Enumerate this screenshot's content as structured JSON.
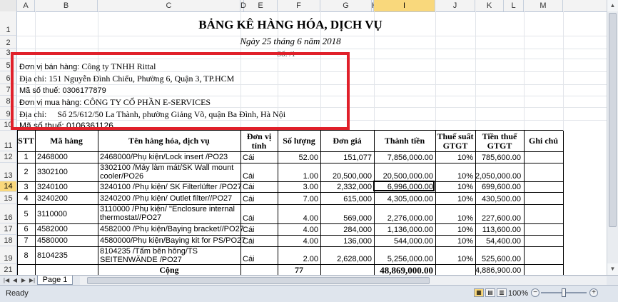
{
  "columns": [
    "A",
    "B",
    "C",
    "D",
    "E",
    "F",
    "G",
    "H",
    "I",
    "J",
    "K",
    "L",
    "M"
  ],
  "selected_column": "I",
  "rows": [
    "1",
    "2",
    "3",
    "5",
    "6",
    "7",
    "8",
    "9",
    "10",
    "11",
    "12",
    "13",
    "14",
    "15",
    "16",
    "17",
    "18",
    "19",
    "20",
    "21"
  ],
  "selected_row": "14",
  "doc": {
    "title": "BẢNG KÊ HÀNG HÓA, DỊCH VỤ",
    "date": "Ngày 25 tháng 6 năm 2018",
    "number": "Số: /1",
    "seller_label": "Đơn vị bán hàng:",
    "seller_name": "Công ty TNHH Rittal",
    "seller_address": "Địa chỉ: 151 Nguyễn Đình Chiểu, Phường 6, Quận 3, TP.HCM",
    "seller_tax": "Mã số thuế: 0306177879",
    "buyer_label": "Đơn vị mua hàng:",
    "buyer_name": "CÔNG TY CỔ PHẦN E-SERVICES",
    "buyer_address_label": "Địa chỉ:",
    "buyer_address": "Số 25/612/50 La Thành, phường Giảng Võ, quận Ba Đình, Hà Nội",
    "buyer_tax": "Mã số thuế: 0106361126"
  },
  "table_headers": {
    "stt": "STT",
    "ma_hang": "Mã hàng",
    "ten_hang": "Tên hàng hóa, dịch vụ",
    "don_vi_1": "Đơn vị",
    "don_vi_2": "tính",
    "so_luong": "Số lượng",
    "don_gia": "Đơn giá",
    "thanh_tien": "Thành tiền",
    "thue_suat_1": "Thuế suất",
    "thue_suat_2": "GTGT",
    "tien_thue_1": "Tiền thuế",
    "tien_thue_2": "GTGT",
    "ghi_chu": "Ghi chú"
  },
  "items": [
    {
      "stt": "1",
      "code": "2468000",
      "name1": "2468000/Phụ kiện/Lock insert /PO23",
      "name2": "",
      "unit": "Cái",
      "qty": "52.00",
      "price": "151,077",
      "amount": "7,856,000.00",
      "rate": "10%",
      "tax": "785,600.00"
    },
    {
      "stt": "2",
      "code": "3302100",
      "name1": "3302100 /Máy làm mát/SK Wall mount",
      "name2": "cooler/PO26",
      "unit": "Cái",
      "qty": "1.00",
      "price": "20,500,000",
      "amount": "20,500,000.00",
      "rate": "10%",
      "tax": "2,050,000.00"
    },
    {
      "stt": "3",
      "code": "3240100",
      "name1": "3240100 /Phụ kiện/ SK Filterlüfter /PO27",
      "name2": "",
      "unit": "Cái",
      "qty": "3.00",
      "price": "2,332,000",
      "amount": "6,996,000.00",
      "rate": "10%",
      "tax": "699,600.00"
    },
    {
      "stt": "4",
      "code": "3240200",
      "name1": "3240200 /Phụ kiện/ Outlet filter//PO27",
      "name2": "",
      "unit": "Cái",
      "qty": "7.00",
      "price": "615,000",
      "amount": "4,305,000.00",
      "rate": "10%",
      "tax": "430,500.00"
    },
    {
      "stt": "5",
      "code": "3110000",
      "name1": "3110000 /Phụ kiện/ \"Enclosure internal",
      "name2": "thermostat//PO27",
      "unit": "Cái",
      "qty": "4.00",
      "price": "569,000",
      "amount": "2,276,000.00",
      "rate": "10%",
      "tax": "227,600.00"
    },
    {
      "stt": "6",
      "code": "4582000",
      "name1": "4582000 /Phụ kiện/Baying bracket//PO27",
      "name2": "",
      "unit": "Cái",
      "qty": "4.00",
      "price": "284,000",
      "amount": "1,136,000.00",
      "rate": "10%",
      "tax": "113,600.00"
    },
    {
      "stt": "7",
      "code": "4580000",
      "name1": "4580000/Phụ kiện/Baying kit for PS/PO27",
      "name2": "",
      "unit": "Cái",
      "qty": "4.00",
      "price": "136,000",
      "amount": "544,000.00",
      "rate": "10%",
      "tax": "54,400.00"
    },
    {
      "stt": "8",
      "code": "8104235",
      "name1": "8104235 /Tấm bên hông/TS",
      "name2": "SEITENWÄNDE /PO27",
      "unit": "Cái",
      "qty": "2.00",
      "price": "2,628,000",
      "amount": "5,256,000.00",
      "rate": "10%",
      "tax": "525,600.00"
    }
  ],
  "total": {
    "label": "Cộng",
    "qty": "77",
    "amount": "48,869,000.00",
    "tax": "4,886,900.00"
  },
  "sheet_tab": "Page 1",
  "status": {
    "ready": "Ready",
    "zoom": "100%"
  },
  "colors": {
    "highlight_box": "#e0202a",
    "selected_header": "#f9d87c"
  }
}
